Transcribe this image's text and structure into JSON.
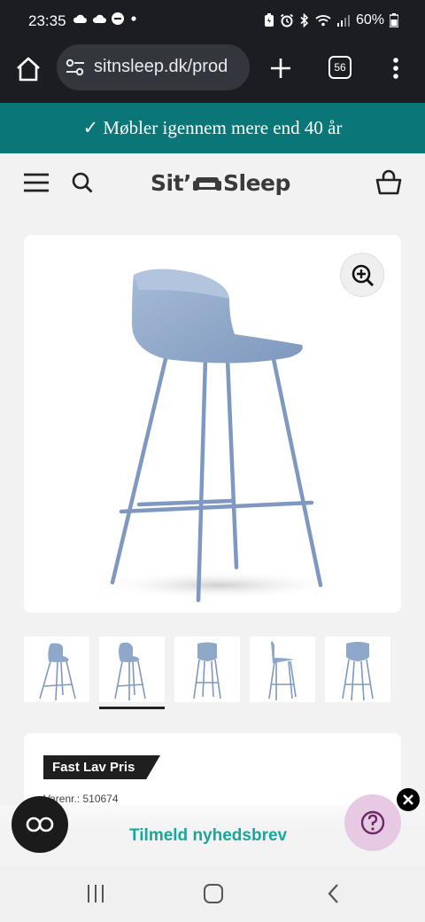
{
  "status_bar": {
    "time": "23:35",
    "battery": "60%"
  },
  "browser": {
    "url": "sitnsleep.dk/prod",
    "tab_count": "56"
  },
  "promo": {
    "text": "✓ Møbler igennem mere end 40 år"
  },
  "header": {
    "logo_left": "Sit’",
    "logo_right": "Sleep"
  },
  "product": {
    "image_color": "#8fa7c8",
    "thumbnail_count": 5,
    "selected_thumbnail": 2
  },
  "info": {
    "badge": "Fast Lav Pris",
    "sku_label": "Varenr.: 510674"
  },
  "newsletter": {
    "text": "Tilmeld nyhedsbrev"
  },
  "colors": {
    "promo_bg": "#0b7677",
    "newsletter_text": "#19a69c",
    "help_bg": "#e8c9e4"
  }
}
